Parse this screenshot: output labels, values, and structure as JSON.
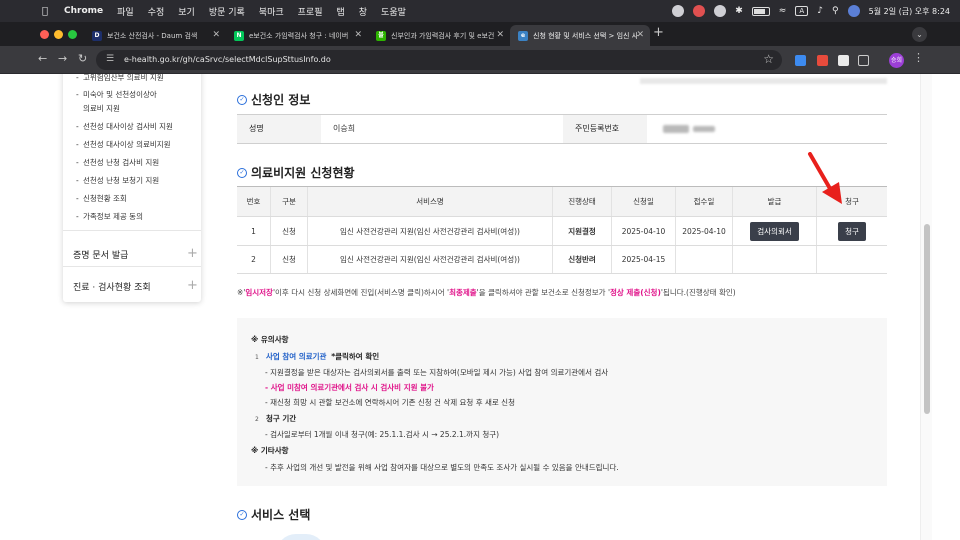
{
  "menubar": {
    "app": "Chrome",
    "items": [
      "파일",
      "수정",
      "보기",
      "방문 기록",
      "북마크",
      "프로필",
      "탭",
      "창",
      "도움말"
    ],
    "keyboard_indicator": "A",
    "datetime": "5월 2일 (금) 오후 8:24"
  },
  "tabs": [
    {
      "title": "보건소 산전검사 - Daum 검색",
      "favicon": "D",
      "color": "#1d2f6b"
    },
    {
      "title": "e보건소 가임력검사 청구 : 네이버",
      "favicon": "N",
      "color": "#03c75a"
    },
    {
      "title": "신부인과 가임력검사 후기 및 e보건",
      "favicon": "블",
      "color": "#2db400"
    },
    {
      "title": "신청 현황 및 서비스 선택 > 임신 사",
      "favicon": "e",
      "color": "#3b82c4"
    }
  ],
  "address": {
    "url": "e-health.go.kr/gh/caSrvc/selectMdclSupSttusInfo.do"
  },
  "profile_label": "승희",
  "sidebar": {
    "sub_items": [
      "고위험임산부 의료비 지원",
      "미숙아 및 선천성이상아",
      "의료비 지원",
      "선천성 대사이상 검사비 지원",
      "선천성 대사이상 의료비지원",
      "선천성 난청 검사비 지원",
      "선천성 난청 보청기 지원",
      "신청현황 조회",
      "가족정보 제공 동의"
    ],
    "sections": [
      "증명 문서 발급",
      "진료 · 검사현황 조회"
    ]
  },
  "applicant": {
    "title": "신청인 정보",
    "name_label": "성명",
    "name_value": "이승희",
    "rrn_label": "주민등록번호"
  },
  "status": {
    "title": "의료비지원 신청현황",
    "columns": [
      "번호",
      "구분",
      "서비스명",
      "진행상태",
      "신청일",
      "접수일",
      "발급",
      "청구"
    ],
    "rows": [
      {
        "no": "1",
        "type": "신청",
        "service": "임신 사전건강관리 지원(임신 사전건강관리 검사비(여성))",
        "state": "지원결정",
        "applied": "2025-04-10",
        "received": "2025-04-10",
        "issue_btn": "검사의뢰서",
        "claim_btn": "청구"
      },
      {
        "no": "2",
        "type": "신청",
        "service": "임신 사전건강관리 지원(임신 사전건강관리 검사비(여성))",
        "state": "신청반려",
        "applied": "2025-04-15",
        "received": "",
        "issue_btn": "",
        "claim_btn": ""
      }
    ],
    "note_parts": [
      "※'",
      "임시저장",
      "'이후 다시 신청 상세화면에 진입(서비스명 클릭)하시어 '",
      "최종제출",
      "'을 클릭하셔야 관할 보건소로 신청정보가 '",
      "정상 제출(신청)",
      "'됩니다.(진행상태 확인)"
    ]
  },
  "notice": {
    "title": "※ 유의사항",
    "n1_num": "1",
    "n1_link": "사업 참여 의료기관",
    "n1_suffix": "*클릭하여 확인",
    "n1_lines": [
      "- 지원결정을 받은 대상자는 검사의뢰서를 출력 또는 지참하여(모바일 제시 가능) 사업 참여 의료기관에서 검사",
      "- 사업 미참여 의료기관에서 검사 시 검사비 지원 불가",
      "- 재신청 희망 시 관할 보건소에 연락하시어 기존 신청 건 삭제 요청 후 새로 신청"
    ],
    "n2_num": "2",
    "n2_title": "청구 기간",
    "n2_line": "- 검사일로부터 1개월 이내 청구(예: 25.1.1.검사 시 → 25.2.1.까지 청구)",
    "other_title": "※ 기타사항",
    "other_line": "- 추후 사업의 개선 및 발전을 위해 사업 참여자를 대상으로 별도의 만족도 조사가 실시될 수 있음을 안내드립니다."
  },
  "service_select": {
    "title": "서비스 선택"
  },
  "colors": {
    "accent_pink": "#e0138a",
    "accent_blue": "#1f5fc8",
    "button_dark": "#3a3f4a",
    "arrow_red": "#e8201c"
  }
}
